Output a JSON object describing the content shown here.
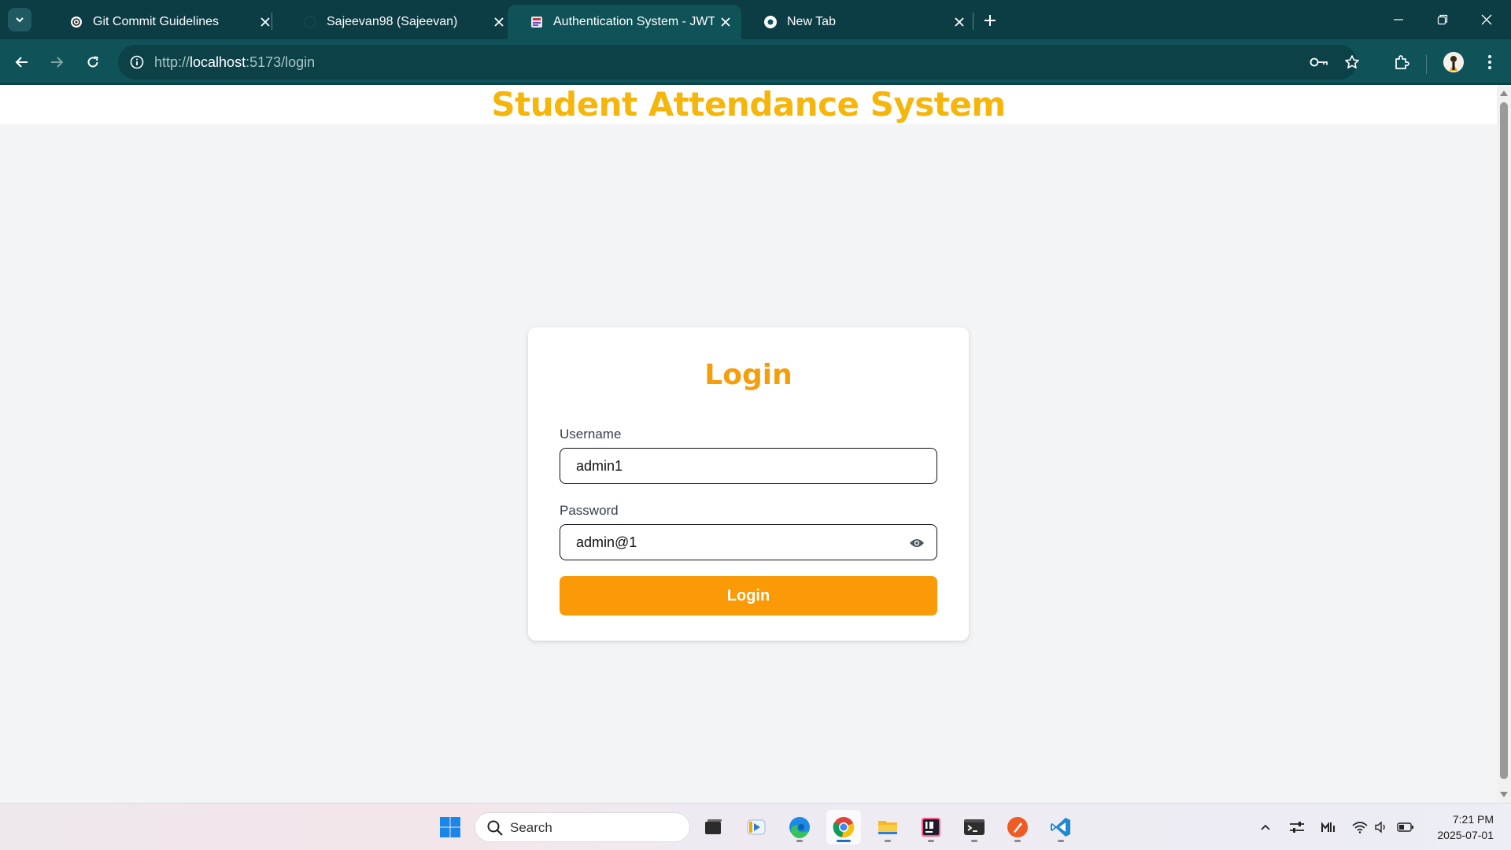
{
  "browser": {
    "tabs": [
      {
        "title": "Git Commit Guidelines",
        "icon": "openai-icon",
        "active": false
      },
      {
        "title": "Sajeevan98 (Sajeevan)",
        "icon": "github-icon",
        "active": false
      },
      {
        "title": "Authentication System - JWT",
        "icon": "vite-icon",
        "active": true
      },
      {
        "title": "New Tab",
        "icon": "chrome-icon",
        "active": false
      }
    ],
    "url_scheme": "http://",
    "url_host": "localhost",
    "url_rest": ":5173/login"
  },
  "page": {
    "app_title": "Student Attendance System",
    "login": {
      "heading": "Login",
      "username_label": "Username",
      "username_value": "admin1",
      "password_label": "Password",
      "password_value": "admin@1",
      "button_label": "Login"
    }
  },
  "colors": {
    "title": "#f5b50a",
    "accent": "#f99a06",
    "browser_frame": "#0f5258"
  },
  "taskbar": {
    "search_placeholder": "Search",
    "time": "7:21 PM",
    "date": "2025-07-01"
  }
}
